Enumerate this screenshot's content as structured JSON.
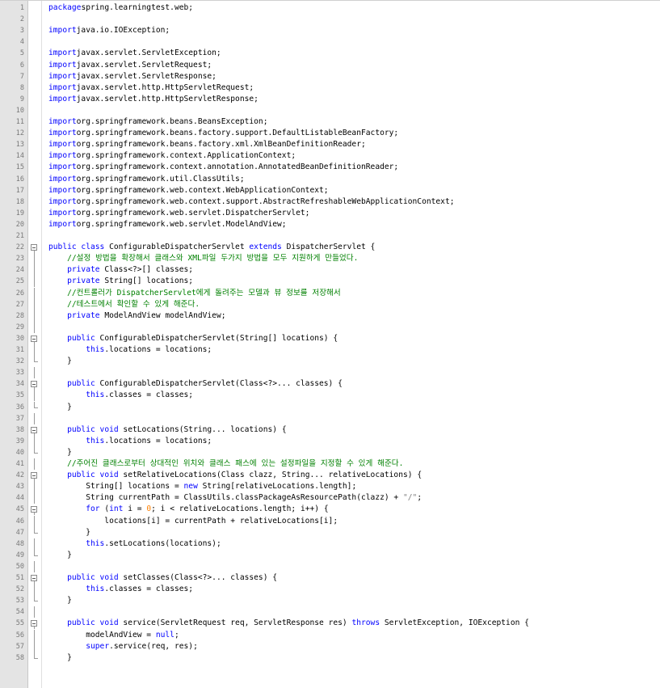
{
  "editor": {
    "lines": [
      {
        "n": "1",
        "fold": "",
        "segs": [
          [
            "kw",
            "package"
          ],
          [
            "",
            "spring.learningtest.web;"
          ]
        ]
      },
      {
        "n": "2",
        "fold": "",
        "segs": []
      },
      {
        "n": "3",
        "fold": "",
        "segs": [
          [
            "kw",
            "import"
          ],
          [
            "",
            "java.io.IOException;"
          ]
        ]
      },
      {
        "n": "4",
        "fold": "",
        "segs": []
      },
      {
        "n": "5",
        "fold": "",
        "segs": [
          [
            "kw",
            "import"
          ],
          [
            "",
            "javax.servlet.ServletException;"
          ]
        ]
      },
      {
        "n": "6",
        "fold": "",
        "segs": [
          [
            "kw",
            "import"
          ],
          [
            "",
            "javax.servlet.ServletRequest;"
          ]
        ]
      },
      {
        "n": "7",
        "fold": "",
        "segs": [
          [
            "kw",
            "import"
          ],
          [
            "",
            "javax.servlet.ServletResponse;"
          ]
        ]
      },
      {
        "n": "8",
        "fold": "",
        "segs": [
          [
            "kw",
            "import"
          ],
          [
            "",
            "javax.servlet.http.HttpServletRequest;"
          ]
        ]
      },
      {
        "n": "9",
        "fold": "",
        "segs": [
          [
            "kw",
            "import"
          ],
          [
            "",
            "javax.servlet.http.HttpServletResponse;"
          ]
        ]
      },
      {
        "n": "10",
        "fold": "",
        "segs": []
      },
      {
        "n": "11",
        "fold": "",
        "segs": [
          [
            "kw",
            "import"
          ],
          [
            "",
            "org.springframework.beans.BeansException;"
          ]
        ]
      },
      {
        "n": "12",
        "fold": "",
        "segs": [
          [
            "kw",
            "import"
          ],
          [
            "",
            "org.springframework.beans.factory.support.DefaultListableBeanFactory;"
          ]
        ]
      },
      {
        "n": "13",
        "fold": "",
        "segs": [
          [
            "kw",
            "import"
          ],
          [
            "",
            "org.springframework.beans.factory.xml.XmlBeanDefinitionReader;"
          ]
        ]
      },
      {
        "n": "14",
        "fold": "",
        "segs": [
          [
            "kw",
            "import"
          ],
          [
            "",
            "org.springframework.context.ApplicationContext;"
          ]
        ]
      },
      {
        "n": "15",
        "fold": "",
        "segs": [
          [
            "kw",
            "import"
          ],
          [
            "",
            "org.springframework.context.annotation.AnnotatedBeanDefinitionReader;"
          ]
        ]
      },
      {
        "n": "16",
        "fold": "",
        "segs": [
          [
            "kw",
            "import"
          ],
          [
            "",
            "org.springframework.util.ClassUtils;"
          ]
        ]
      },
      {
        "n": "17",
        "fold": "",
        "segs": [
          [
            "kw",
            "import"
          ],
          [
            "",
            "org.springframework.web.context.WebApplicationContext;"
          ]
        ]
      },
      {
        "n": "18",
        "fold": "",
        "segs": [
          [
            "kw",
            "import"
          ],
          [
            "",
            "org.springframework.web.context.support.AbstractRefreshableWebApplicationContext;"
          ]
        ]
      },
      {
        "n": "19",
        "fold": "",
        "segs": [
          [
            "kw",
            "import"
          ],
          [
            "",
            "org.springframework.web.servlet.DispatcherServlet;"
          ]
        ]
      },
      {
        "n": "20",
        "fold": "",
        "segs": [
          [
            "kw",
            "import"
          ],
          [
            "",
            "org.springframework.web.servlet.ModelAndView;"
          ]
        ]
      },
      {
        "n": "21",
        "fold": "",
        "segs": []
      },
      {
        "n": "22",
        "fold": "open",
        "segs": [
          [
            "kw",
            "public class"
          ],
          [
            "",
            " ConfigurableDispatcherServlet "
          ],
          [
            "kw",
            "extends"
          ],
          [
            "",
            " DispatcherServlet {"
          ]
        ]
      },
      {
        "n": "23",
        "fold": "line",
        "segs": [
          [
            "",
            "    "
          ],
          [
            "cm",
            "//설정 방법을 확장해서 클래스와 XML파일 두가지 방법을 모두 지원하게 만들었다."
          ]
        ]
      },
      {
        "n": "24",
        "fold": "line",
        "segs": [
          [
            "",
            "    "
          ],
          [
            "kw",
            "private"
          ],
          [
            "",
            " Class<?>[] classes;"
          ]
        ]
      },
      {
        "n": "25",
        "fold": "line",
        "segs": [
          [
            "",
            "    "
          ],
          [
            "kw",
            "private"
          ],
          [
            "",
            " String[] locations;"
          ]
        ]
      },
      {
        "n": "26",
        "fold": "line",
        "segs": [
          [
            "",
            "    "
          ],
          [
            "cm",
            "//컨트롤러가 DispatcherServlet에게 돌려주는 모델과 뷰 정보를 저장해서"
          ]
        ]
      },
      {
        "n": "27",
        "fold": "line",
        "segs": [
          [
            "",
            "    "
          ],
          [
            "cm",
            "//테스트에서 확인할 수 있게 해준다."
          ]
        ]
      },
      {
        "n": "28",
        "fold": "line",
        "segs": [
          [
            "",
            "    "
          ],
          [
            "kw",
            "private"
          ],
          [
            "",
            " ModelAndView modelAndView;"
          ]
        ]
      },
      {
        "n": "29",
        "fold": "line",
        "segs": []
      },
      {
        "n": "30",
        "fold": "open",
        "segs": [
          [
            "",
            "    "
          ],
          [
            "kw",
            "public"
          ],
          [
            "",
            " ConfigurableDispatcherServlet(String[] locations) {"
          ]
        ]
      },
      {
        "n": "31",
        "fold": "line",
        "segs": [
          [
            "",
            "        "
          ],
          [
            "kw",
            "this"
          ],
          [
            "",
            ".locations = locations;"
          ]
        ]
      },
      {
        "n": "32",
        "fold": "end",
        "segs": [
          [
            "",
            "    }"
          ]
        ]
      },
      {
        "n": "33",
        "fold": "line",
        "segs": []
      },
      {
        "n": "34",
        "fold": "open",
        "segs": [
          [
            "",
            "    "
          ],
          [
            "kw",
            "public"
          ],
          [
            "",
            " ConfigurableDispatcherServlet(Class<?>... classes) {"
          ]
        ]
      },
      {
        "n": "35",
        "fold": "line",
        "segs": [
          [
            "",
            "        "
          ],
          [
            "kw",
            "this"
          ],
          [
            "",
            ".classes = classes;"
          ]
        ]
      },
      {
        "n": "36",
        "fold": "end",
        "segs": [
          [
            "",
            "    }"
          ]
        ]
      },
      {
        "n": "37",
        "fold": "line",
        "segs": []
      },
      {
        "n": "38",
        "fold": "open",
        "segs": [
          [
            "",
            "    "
          ],
          [
            "kw",
            "public void"
          ],
          [
            "",
            " setLocations(String... locations) {"
          ]
        ]
      },
      {
        "n": "39",
        "fold": "line",
        "segs": [
          [
            "",
            "        "
          ],
          [
            "kw",
            "this"
          ],
          [
            "",
            ".locations = locations;"
          ]
        ]
      },
      {
        "n": "40",
        "fold": "end",
        "segs": [
          [
            "",
            "    }"
          ]
        ]
      },
      {
        "n": "41",
        "fold": "line",
        "segs": [
          [
            "",
            "    "
          ],
          [
            "cm",
            "//주어진 클래스로부터 상대적인 위치와 클래스 패스에 있는 설정파일을 지정할 수 있게 해준다."
          ]
        ]
      },
      {
        "n": "42",
        "fold": "open",
        "segs": [
          [
            "",
            "    "
          ],
          [
            "kw",
            "public void"
          ],
          [
            "",
            " setRelativeLocations(Class clazz, String... relativeLocations) {"
          ]
        ]
      },
      {
        "n": "43",
        "fold": "line",
        "segs": [
          [
            "",
            "        String[] locations = "
          ],
          [
            "kw",
            "new"
          ],
          [
            "",
            " String[relativeLocations.length];"
          ]
        ]
      },
      {
        "n": "44",
        "fold": "line",
        "segs": [
          [
            "",
            "        String currentPath = ClassUtils.classPackageAsResourcePath(clazz) + "
          ],
          [
            "st",
            "\"/\""
          ],
          [
            "",
            ";"
          ]
        ]
      },
      {
        "n": "45",
        "fold": "open",
        "segs": [
          [
            "",
            "        "
          ],
          [
            "kw",
            "for"
          ],
          [
            "",
            " ("
          ],
          [
            "kw",
            "int"
          ],
          [
            "",
            " i = "
          ],
          [
            "nm",
            "0"
          ],
          [
            "",
            "; i < relativeLocations.length; i++) {"
          ]
        ]
      },
      {
        "n": "46",
        "fold": "line",
        "segs": [
          [
            "",
            "            locations[i] = currentPath + relativeLocations[i];"
          ]
        ]
      },
      {
        "n": "47",
        "fold": "end",
        "segs": [
          [
            "",
            "        }"
          ]
        ]
      },
      {
        "n": "48",
        "fold": "line",
        "segs": [
          [
            "",
            "        "
          ],
          [
            "kw",
            "this"
          ],
          [
            "",
            ".setLocations(locations);"
          ]
        ]
      },
      {
        "n": "49",
        "fold": "end",
        "segs": [
          [
            "",
            "    }"
          ]
        ]
      },
      {
        "n": "50",
        "fold": "line",
        "segs": []
      },
      {
        "n": "51",
        "fold": "open",
        "segs": [
          [
            "",
            "    "
          ],
          [
            "kw",
            "public void"
          ],
          [
            "",
            " setClasses(Class<?>... classes) {"
          ]
        ]
      },
      {
        "n": "52",
        "fold": "line",
        "segs": [
          [
            "",
            "        "
          ],
          [
            "kw",
            "this"
          ],
          [
            "",
            ".classes = classes;"
          ]
        ]
      },
      {
        "n": "53",
        "fold": "end",
        "segs": [
          [
            "",
            "    }"
          ]
        ]
      },
      {
        "n": "54",
        "fold": "line",
        "segs": []
      },
      {
        "n": "55",
        "fold": "open",
        "segs": [
          [
            "",
            "    "
          ],
          [
            "kw",
            "public void"
          ],
          [
            "",
            " service(ServletRequest req, ServletResponse res) "
          ],
          [
            "kw",
            "throws"
          ],
          [
            "",
            " ServletException, IOException {"
          ]
        ]
      },
      {
        "n": "56",
        "fold": "line",
        "segs": [
          [
            "",
            "        modelAndView = "
          ],
          [
            "kw",
            "null"
          ],
          [
            "",
            ";"
          ]
        ]
      },
      {
        "n": "57",
        "fold": "line",
        "segs": [
          [
            "",
            "        "
          ],
          [
            "kw",
            "super"
          ],
          [
            "",
            ".service(req, res);"
          ]
        ]
      },
      {
        "n": "58",
        "fold": "end",
        "segs": [
          [
            "",
            "    }"
          ]
        ]
      }
    ]
  }
}
